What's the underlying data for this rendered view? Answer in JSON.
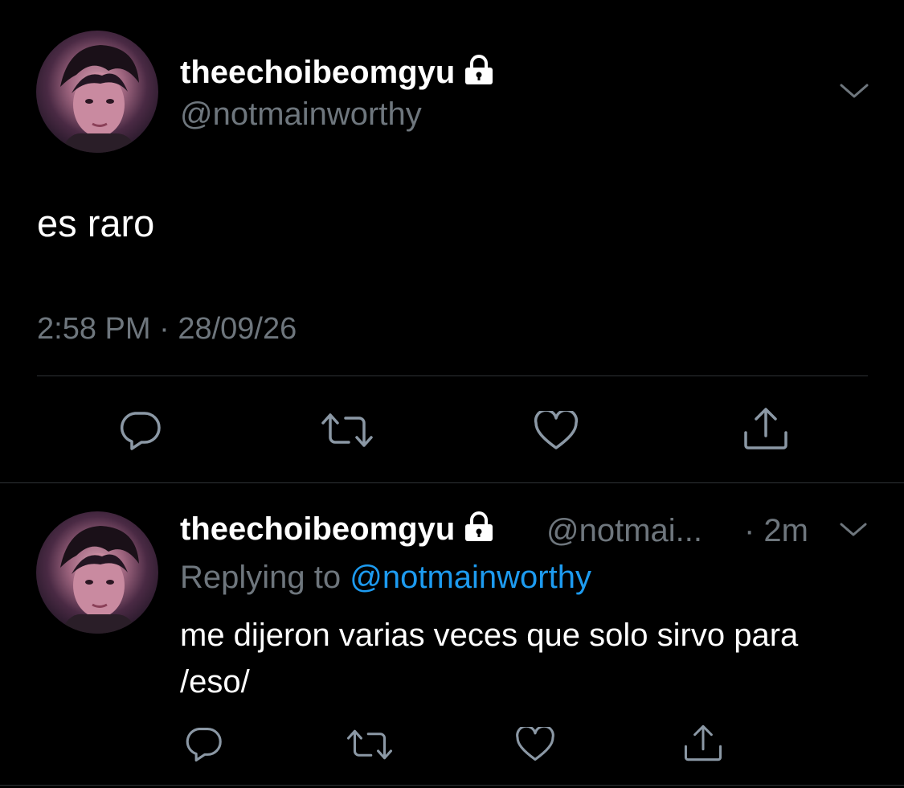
{
  "main_tweet": {
    "display_name": "theechoibeomgyu",
    "handle": "@notmainworthy",
    "text": "es raro",
    "time": "2:58 PM",
    "separator": "·",
    "date": "28/09/26",
    "icons": [
      "avatar",
      "lock-icon",
      "chevron-down-icon",
      "reply-icon",
      "retweet-icon",
      "like-icon",
      "share-icon"
    ]
  },
  "reply_tweet": {
    "display_name": "theechoibeomgyu",
    "handle_truncated": "@notmai...",
    "age": "· 2m",
    "replying_prefix": "Replying to",
    "replying_mention": "@notmainworthy",
    "text": "me dijeron varias veces que solo sirvo para /eso/",
    "icons": [
      "avatar",
      "lock-icon",
      "chevron-down-icon",
      "reply-icon",
      "retweet-icon",
      "like-icon",
      "share-icon"
    ]
  },
  "colors": {
    "background": "#000000",
    "primary_text": "#ffffff",
    "secondary_text": "#6e767d",
    "link": "#1d9bf0",
    "divider": "#2f3336",
    "icon": "#8b98a5"
  }
}
